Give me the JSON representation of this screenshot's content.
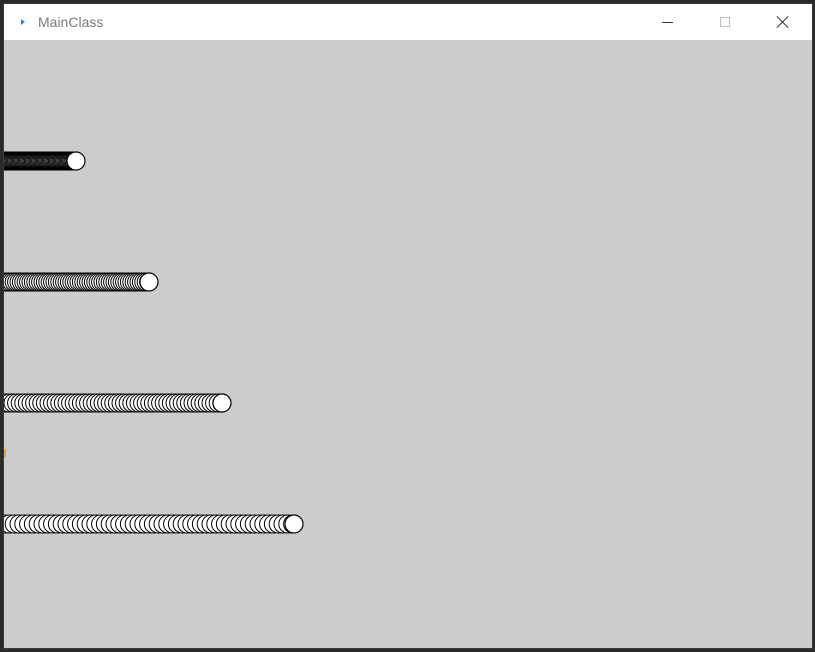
{
  "window": {
    "title": "MainClass",
    "icon": "app-arrow-icon",
    "controls": {
      "minimize_icon": "minimize-icon",
      "maximize_icon": "maximize-icon",
      "close_icon": "close-icon"
    }
  },
  "canvas": {
    "background": "#cccccc",
    "trails": [
      {
        "name": "trail-1",
        "ball_color": "#ffffff",
        "stroke": "#000000"
      },
      {
        "name": "trail-2",
        "ball_color": "#ffffff",
        "stroke": "#000000"
      },
      {
        "name": "trail-3",
        "ball_color": "#ffffff",
        "stroke": "#000000"
      },
      {
        "name": "trail-4",
        "ball_color": "#ffffff",
        "stroke": "#000000"
      }
    ]
  }
}
